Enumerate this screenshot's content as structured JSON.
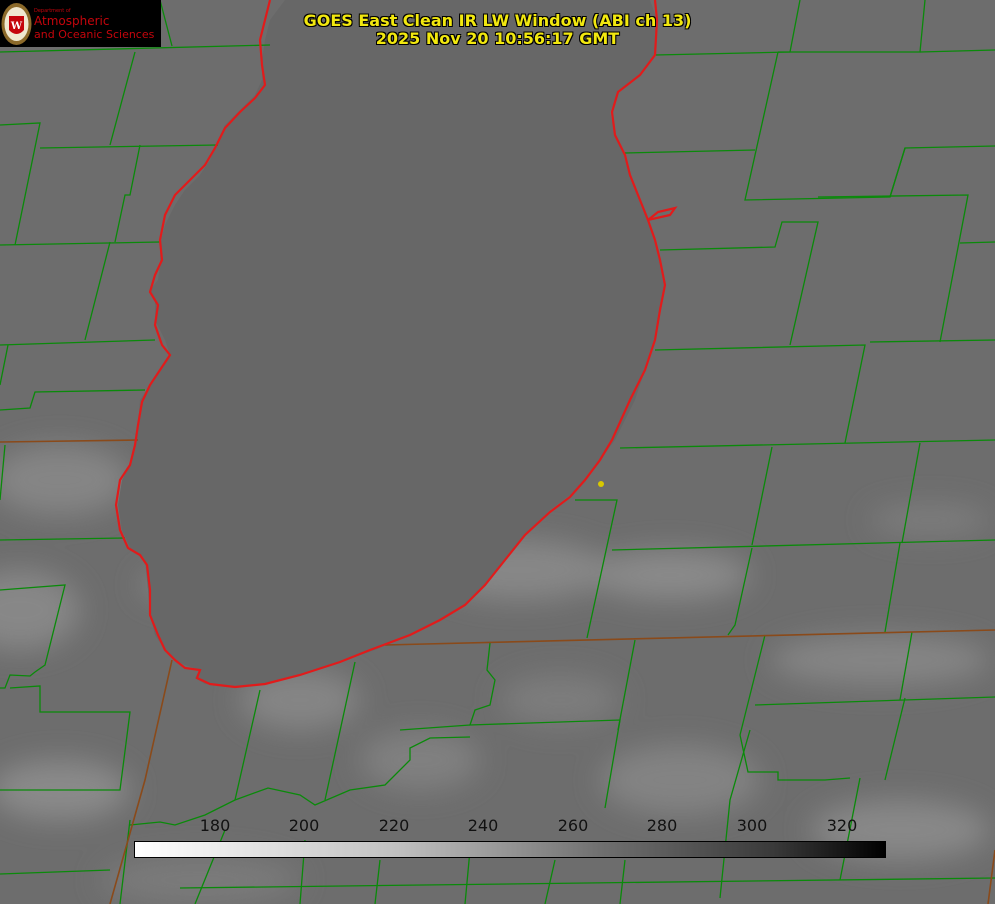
{
  "title": {
    "line1": "GOES East Clean IR LW Window (ABI ch 13)",
    "line2": "2025 Nov 20 10:56:17 GMT"
  },
  "logo": {
    "department": "Department of",
    "line1": "Atmospheric",
    "line2": "and Oceanic Sciences"
  },
  "colorbar": {
    "ticks": [
      "180",
      "200",
      "220",
      "240",
      "260",
      "280",
      "300",
      "320"
    ],
    "min_value": 162,
    "max_value": 330,
    "gradient": "white-to-black"
  },
  "colors": {
    "lake_outline": "#e11b1b",
    "county_lines": "#0a8a0a",
    "state_lines": "#8a4a1a",
    "title_text": "#f2e80f",
    "marker": "#d8c800"
  },
  "map": {
    "feature": "lake",
    "marker_present": true
  }
}
